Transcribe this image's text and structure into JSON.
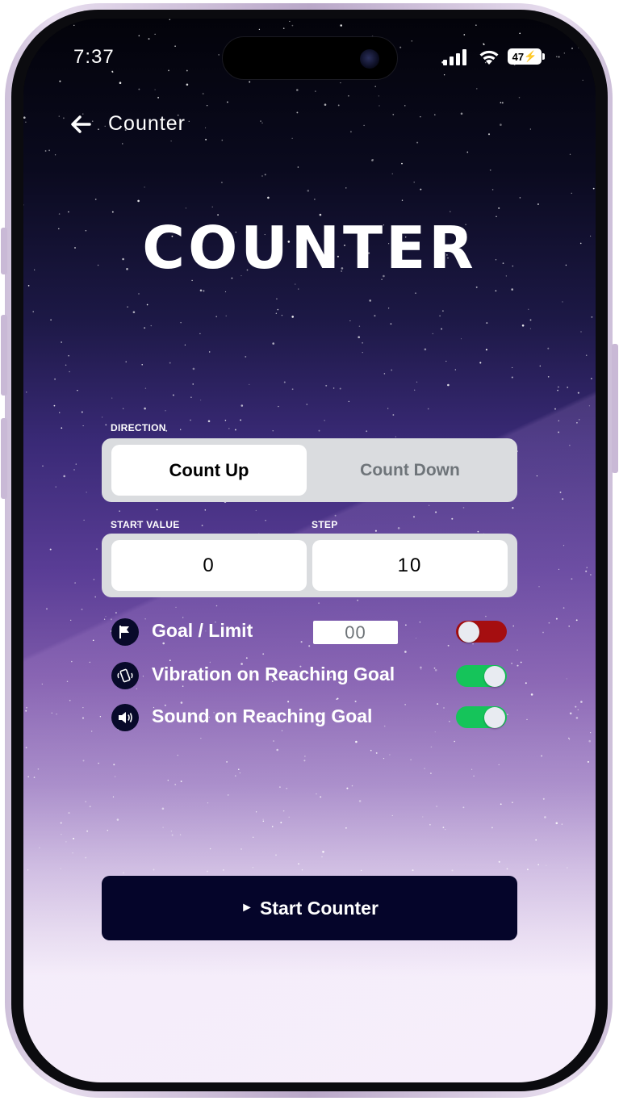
{
  "status_bar": {
    "time": "7:37",
    "battery": "47"
  },
  "header": {
    "title": "Counter"
  },
  "hero_title": "COUNTER",
  "direction": {
    "label": "DIRECTION",
    "options": [
      "Count Up",
      "Count Down"
    ],
    "selected": "Count Up"
  },
  "start_value": {
    "label": "START VALUE",
    "value": "0"
  },
  "step": {
    "label": "STEP",
    "value": "10"
  },
  "options": [
    {
      "label": "Goal / Limit",
      "icon": "flag-icon",
      "enabled": false,
      "value": "00"
    },
    {
      "label": "Vibration on Reaching Goal",
      "icon": "vibration-icon",
      "enabled": true
    },
    {
      "label": "Sound on Reaching Goal",
      "icon": "speaker-icon",
      "enabled": true
    }
  ],
  "start_button": {
    "label": "Start Counter",
    "icon": "play-icon"
  },
  "colors": {
    "toggle_on": "#15c45a",
    "toggle_off": "#a50e10",
    "button_bg": "#05052a",
    "segment_bg": "#dadcdf"
  }
}
